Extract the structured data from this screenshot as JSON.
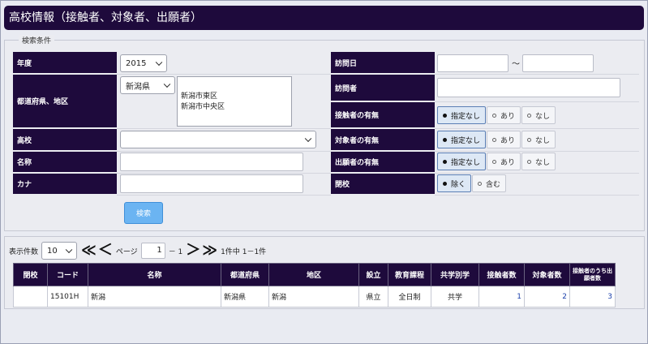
{
  "title": "高校情報（接触者、対象者、出願者）",
  "search": {
    "legend": "検索条件",
    "labels": {
      "year": "年度",
      "prefecture": "都道府県、地区",
      "school": "高校",
      "name": "名称",
      "kana": "カナ",
      "visit_date": "訪問日",
      "visitor": "訪問者",
      "contact": "接触者の有無",
      "target": "対象者の有無",
      "applicant": "出願者の有無",
      "closed": "閉校"
    },
    "year_value": "2015",
    "prefecture_value": "新潟県",
    "districts": [
      "新潟市東区",
      "新潟市中央区"
    ],
    "date_separator": "～",
    "radio_options": [
      "指定なし",
      "あり",
      "なし"
    ],
    "closed_options": [
      "除く",
      "含む"
    ],
    "search_button": "検索"
  },
  "pager": {
    "label_count": "表示件数",
    "count_value": "10",
    "first": "≪",
    "prev": "＜",
    "page_label": "ページ",
    "page_value": "1",
    "page_total": "－ 1",
    "next": "＞",
    "last": "≫",
    "summary": "1件中 1－1件"
  },
  "table": {
    "headers": [
      "閉校",
      "コード",
      "名称",
      "都道府県",
      "地区",
      "設立",
      "教育課程",
      "共学別学",
      "接触者数",
      "対象者数",
      "接触者のうち出願者数"
    ],
    "rows": [
      [
        "",
        "15101H",
        "新潟",
        "新潟県",
        "新潟",
        "県立",
        "全日制",
        "共学",
        "1",
        "2",
        "3"
      ]
    ]
  }
}
